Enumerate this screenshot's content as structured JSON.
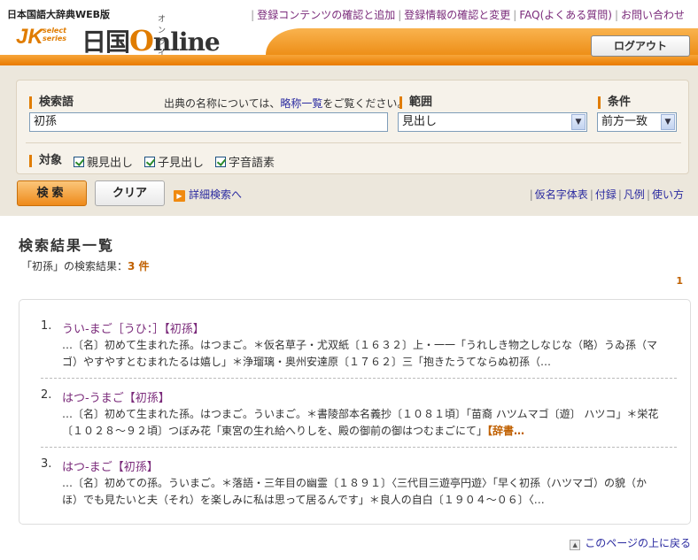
{
  "header": {
    "subtitle": "日本国語大辞典WEB版",
    "logo": {
      "jk": "JK",
      "series_line1": "select",
      "series_line2": "series",
      "name_prefix": "日国",
      "name_o": "O",
      "name_suffix": "nline",
      "kana": "オンライン"
    },
    "links": [
      "登録コンテンツの確認と追加",
      "登録情報の確認と変更",
      "FAQ(よくある質問)",
      "お問い合わせ"
    ],
    "logout": "ログアウト"
  },
  "search": {
    "keyword_label": "検索語",
    "note_before": "出典の名称については、",
    "note_link": "略称一覧",
    "note_after": "をご覧ください。",
    "keyword_value": "初孫",
    "range_label": "範囲",
    "range_value": "見出し",
    "condition_label": "条件",
    "condition_value": "前方一致",
    "target_label": "対象",
    "targets": [
      "親見出し",
      "子見出し",
      "字音語素"
    ],
    "search_button": "検索",
    "clear_button": "クリア",
    "advanced_link": "詳細検索へ",
    "help_links": [
      "仮名字体表",
      "付録",
      "凡例",
      "使い方"
    ]
  },
  "results": {
    "title": "検索結果一覧",
    "summary_prefix": "「初孫」の検索結果：",
    "summary_count": "3 件",
    "page": "1",
    "entries": [
      {
        "num": "1.",
        "head": "うい‐まご［うひ：］【初孫】",
        "line1": "…〔名〕初めて生まれた孫。はつまご。＊仮名草子・尤双紙〔１６３２〕上・一一「うれしき物之しなじな（略）うゐ孫（マ",
        "line2": "ゴ）やすやすとむまれたるは嬉し」＊浄瑠璃・奥州安達原〔１７６２〕三「抱きたうてならぬ初孫（…",
        "more": ""
      },
      {
        "num": "2.",
        "head": "はつ‐うまご【初孫】",
        "line1": "…〔名〕初めて生まれた孫。はつまご。ういまご。＊書陵部本名義抄〔１０８１頃〕「苗裔 ハツムマゴ〔遊〕 ハツコ」＊栄花",
        "line2": "〔１０２８～９２頃〕つぼみ花「東宮の生れ給へりしを、殿の御前の御はつむまごにて」",
        "more": "【辞書…"
      },
      {
        "num": "3.",
        "head": "はつ‐まご【初孫】",
        "line1": "…〔名〕初めての孫。ういまご。＊落語・三年目の幽霊〔１８９１〕〈三代目三遊亭円遊〉「早く初孫（ハツマゴ）の貌（か",
        "line2": "ほ）でも見たいと夫（それ）を楽しみに私は思って居るんです」＊良人の自白〔１９０４～０６〕〈…",
        "more": ""
      }
    ],
    "to_top": "このページの上に戻る"
  }
}
